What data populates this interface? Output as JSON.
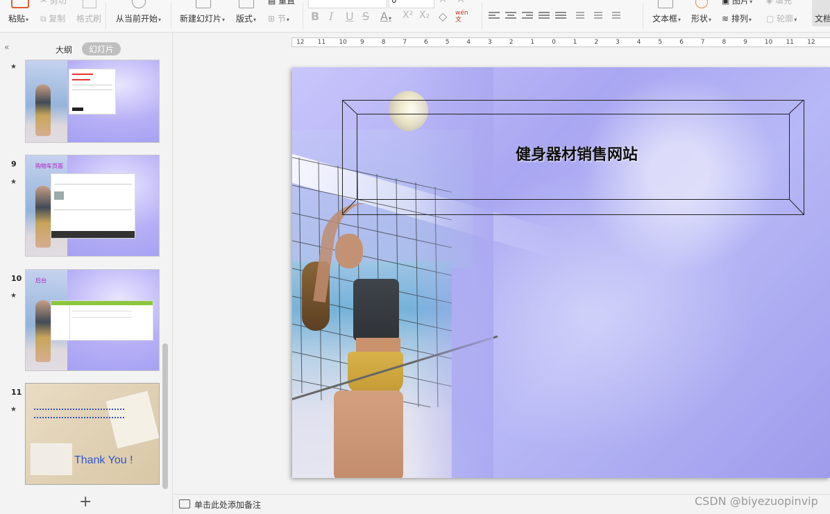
{
  "ribbon": {
    "paste": "粘贴",
    "copy": "复制",
    "format_painter": "格式刷",
    "cut_partial": "剪切",
    "from_current": "从当前开始",
    "new_slide": "新建幻灯片",
    "layout": "版式",
    "section": "节",
    "reset_partial": "重置",
    "font_size_value": "0",
    "phonetic": "wén\n文",
    "textbox": "文本框",
    "shape": "形状",
    "arrange": "排列",
    "outline": "轮廓",
    "image_partial": "图片",
    "fill_partial": "填充",
    "text_partial": "文档"
  },
  "panel": {
    "collapse": "«",
    "tab_outline": "大纲",
    "tab_slides": "幻灯片",
    "add_slide": "+"
  },
  "thumbnails": [
    {
      "num": "",
      "star": "★",
      "caption": ""
    },
    {
      "num": "9",
      "star": "★",
      "caption": "购物车页面"
    },
    {
      "num": "10",
      "star": "★",
      "caption": "后台"
    },
    {
      "num": "11",
      "star": "★",
      "caption": "Thank You !"
    }
  ],
  "slide": {
    "title": "健身器材销售网站"
  },
  "ruler": [
    "12",
    "11",
    "10",
    "9",
    "8",
    "7",
    "6",
    "5",
    "4",
    "3",
    "2",
    "1",
    "0",
    "1",
    "2",
    "3",
    "4",
    "5",
    "6",
    "7",
    "8",
    "9",
    "10",
    "11",
    "12"
  ],
  "notes": {
    "placeholder": "单击此处添加备注"
  },
  "watermark": "CSDN @biyezuopinvip"
}
